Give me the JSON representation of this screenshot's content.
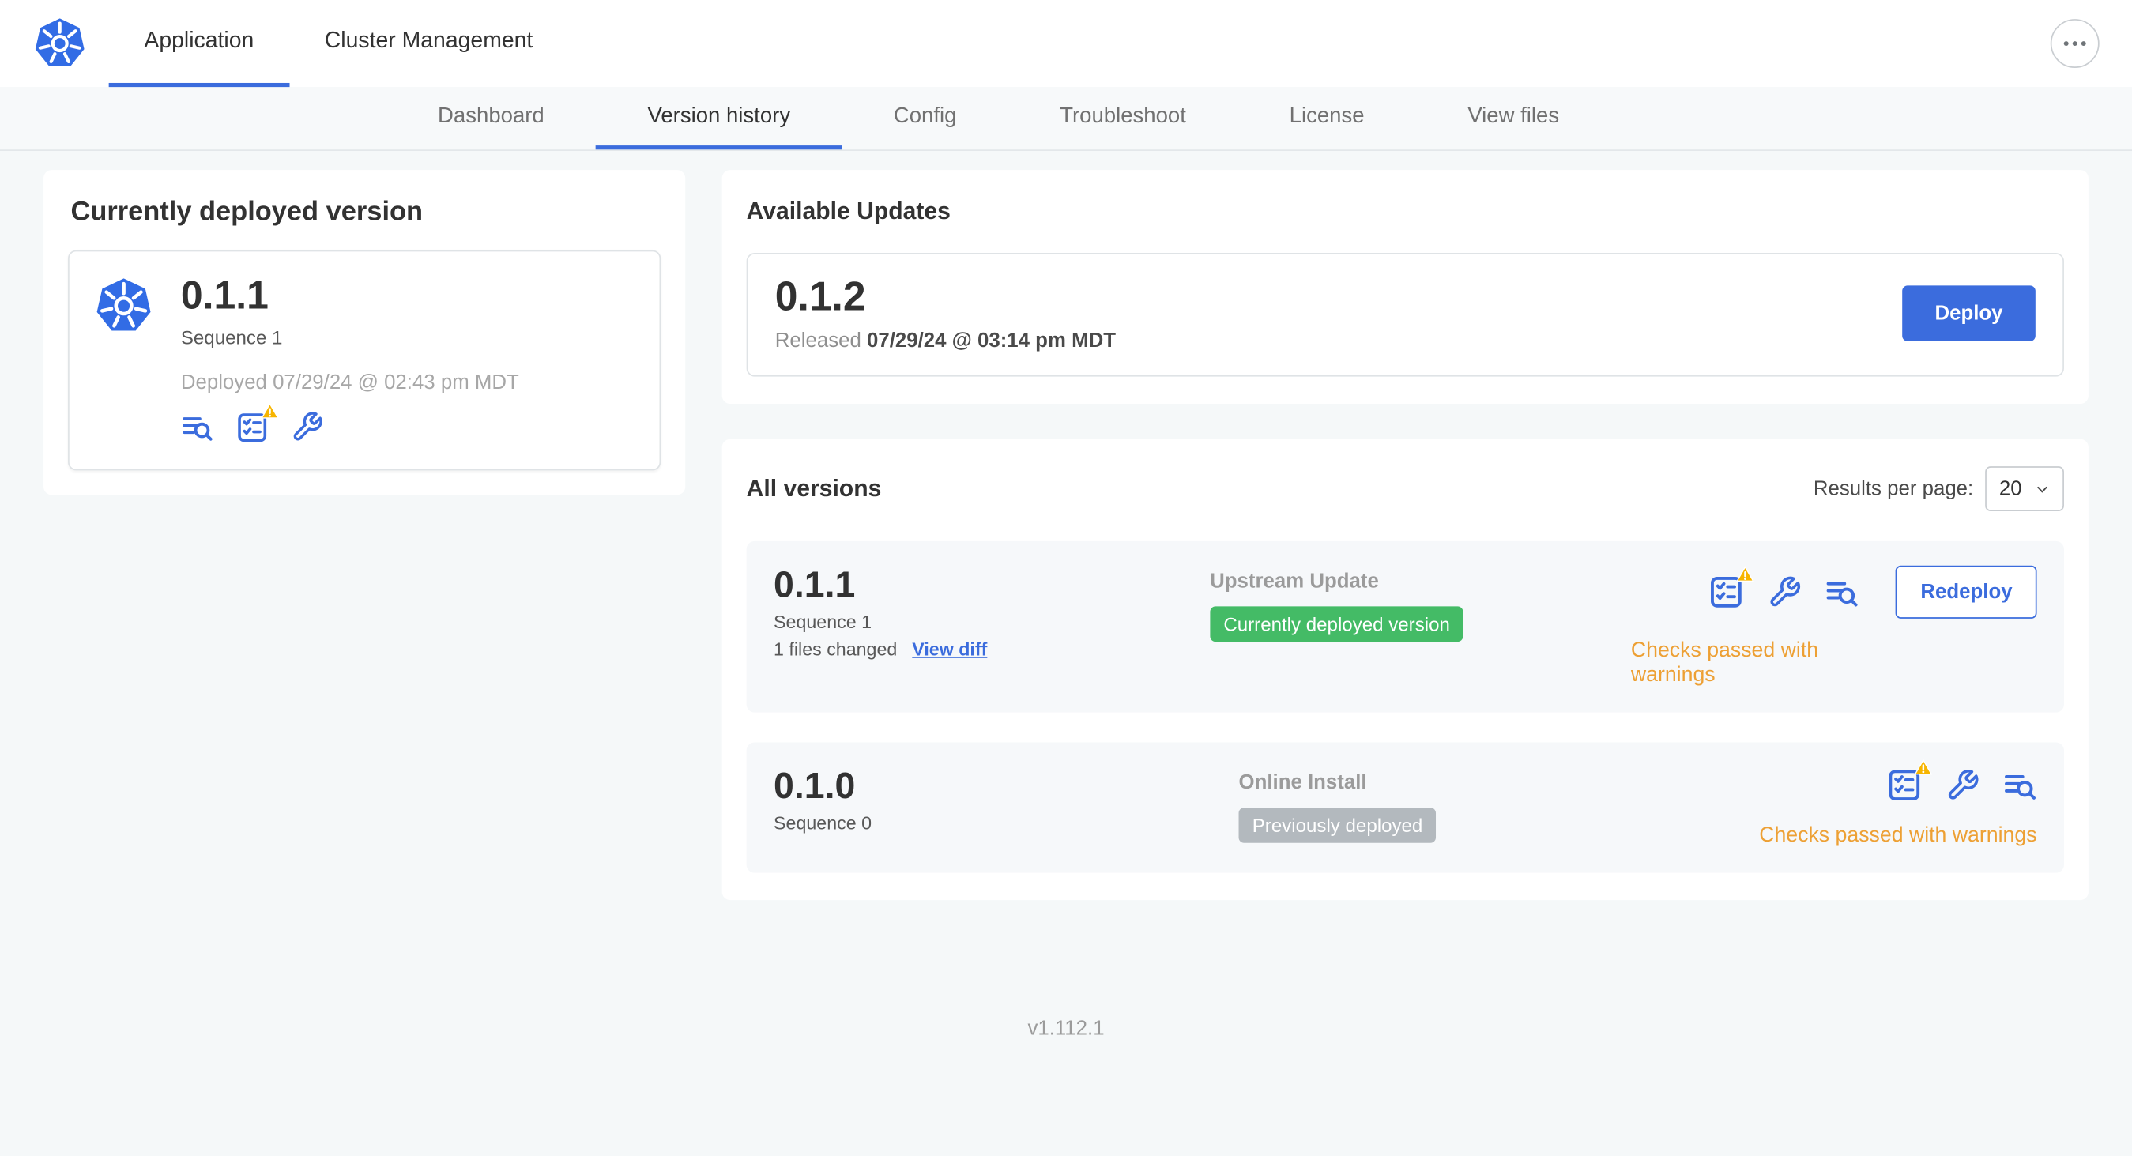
{
  "header": {
    "tabs": [
      {
        "label": "Application",
        "active": true
      },
      {
        "label": "Cluster Management",
        "active": false
      }
    ]
  },
  "subnav": {
    "tabs": [
      {
        "label": "Dashboard",
        "active": false
      },
      {
        "label": "Version history",
        "active": true
      },
      {
        "label": "Config",
        "active": false
      },
      {
        "label": "Troubleshoot",
        "active": false
      },
      {
        "label": "License",
        "active": false
      },
      {
        "label": "View files",
        "active": false
      }
    ]
  },
  "current_version": {
    "title": "Currently deployed version",
    "version": "0.1.1",
    "sequence": "Sequence 1",
    "deployed": "Deployed 07/29/24 @ 02:43 pm MDT"
  },
  "available_updates": {
    "title": "Available Updates",
    "version": "0.1.2",
    "released_label": "Released",
    "released_date": "07/29/24 @ 03:14 pm MDT",
    "deploy_label": "Deploy"
  },
  "all_versions": {
    "title": "All versions",
    "results_per_page_label": "Results per page:",
    "results_per_page_value": "20",
    "rows": [
      {
        "version": "0.1.1",
        "sequence": "Sequence 1",
        "files_changed": "1 files changed",
        "view_diff_label": "View diff",
        "source": "Upstream Update",
        "badge": "Currently deployed version",
        "badge_type": "green",
        "checks": "Checks passed with warnings",
        "action_label": "Redeploy"
      },
      {
        "version": "0.1.0",
        "sequence": "Sequence 0",
        "source": "Online Install",
        "badge": "Previously deployed",
        "badge_type": "gray",
        "checks": "Checks passed with warnings"
      }
    ]
  },
  "footer": {
    "version": "v1.112.1"
  },
  "icons": {
    "logo": "kubernetes-logo-icon",
    "header_menu": "ellipsis-icon",
    "logs": "view-logs-icon",
    "checks": "preflight-checklist-icon",
    "config": "wrench-icon",
    "warning": "warning-triangle-icon",
    "select": "chevron-down-icon"
  },
  "colors": {
    "accent_blue": "#3b6cdd",
    "logo_blue": "#326ce5",
    "badge_green": "#44bb66",
    "badge_gray": "#b3b9be",
    "warning_orange": "#eda034",
    "warning_triangle": "#f7b500",
    "page_background": "#f5f8f9",
    "row_background": "#f6f8fa"
  }
}
